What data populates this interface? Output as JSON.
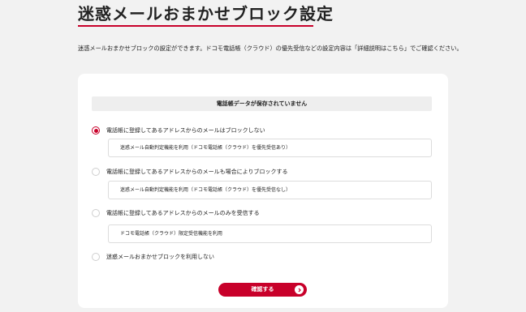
{
  "page": {
    "title": "迷惑メールおまかせブロック設定",
    "description": "迷惑メールおまかせブロックの設定ができます。ドコモ電話帳（クラウド）の優先受信などの設定内容は「詳細説明はこちら」でご確認ください。"
  },
  "card": {
    "status_message": "電話帳データが保存されていません",
    "options": [
      {
        "label": "電話帳に登録してあるアドレスからのメールはブロックしない",
        "note": "迷惑メール自動判定機能を利用（ドコモ電話帳（クラウド）を優先受信あり）",
        "selected": true
      },
      {
        "label": "電話帳に登録してあるアドレスからのメールも場合によりブロックする",
        "note": "迷惑メール自動判定機能を利用（ドコモ電話帳（クラウド）を優先受信なし）",
        "selected": false
      },
      {
        "label": "電話帳に登録してあるアドレスからのメールのみを受信する",
        "note": "ドコモ電話帳（クラウド）限定受信機能を利用",
        "selected": false
      },
      {
        "label": "迷惑メールおまかせブロックを利用しない",
        "selected": false
      }
    ],
    "confirm_label": "確認する",
    "confirm_icon": "chevron-right-circle-icon"
  },
  "colors": {
    "accent": "#c8002a",
    "background": "#f2f2f2",
    "card": "#ffffff"
  }
}
